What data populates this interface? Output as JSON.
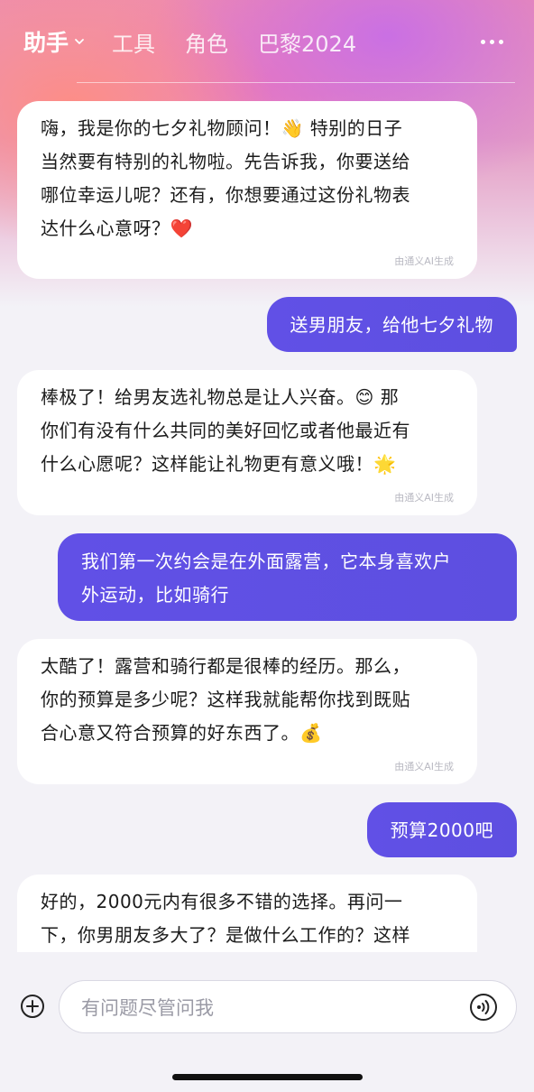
{
  "nav": {
    "tabs": [
      "助手",
      "工具",
      "角色",
      "巴黎2024"
    ],
    "active_index": 0
  },
  "messages": [
    {
      "role": "ai",
      "lines": [
        "嗨，我是你的七夕礼物顾问！👋 特别的日子",
        "当然要有特别的礼物啦。先告诉我，你要送给",
        "哪位幸运儿呢？还有，你想要通过这份礼物表",
        "达什么心意呀？❤️"
      ],
      "tag": "由通义AI生成"
    },
    {
      "role": "user",
      "lines": [
        "送男朋友，给他七夕礼物"
      ]
    },
    {
      "role": "ai",
      "lines": [
        "棒极了！给男友选礼物总是让人兴奋。😊 那",
        "你们有没有什么共同的美好回忆或者他最近有",
        "什么心愿呢？这样能让礼物更有意义哦！🌟"
      ],
      "tag": "由通义AI生成"
    },
    {
      "role": "user",
      "lines": [
        "我们第一次约会是在外面露营，它本身喜欢户",
        "外运动，比如骑行"
      ]
    },
    {
      "role": "ai",
      "lines": [
        "太酷了！露营和骑行都是很棒的经历。那么，",
        "你的预算是多少呢？这样我就能帮你找到既贴",
        "合心意又符合预算的好东西了。💰"
      ],
      "tag": "由通义AI生成"
    },
    {
      "role": "user",
      "lines": [
        "预算2000吧"
      ]
    },
    {
      "role": "ai",
      "lines": [
        "好的，2000元内有很多不错的选择。再问一",
        "下，你男朋友多大了？是做什么工作的？这样"
      ],
      "tag": ""
    }
  ],
  "input": {
    "placeholder": "有问题尽管问我"
  },
  "colors": {
    "user_bubble": "#5d4fe0",
    "ai_bubble": "#ffffff",
    "background": "#f3f2f7"
  }
}
